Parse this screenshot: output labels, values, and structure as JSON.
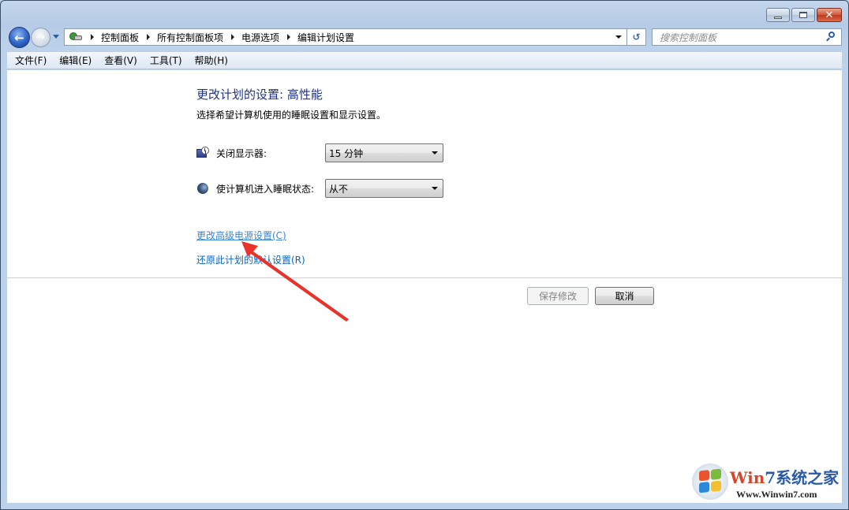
{
  "window": {
    "caption_buttons": {
      "minimize": "minimize",
      "maximize": "maximize",
      "close": "✕"
    }
  },
  "navigation": {
    "back_icon": "arrow-left-icon",
    "forward_icon": "arrow-right-icon",
    "back_glyph": "←",
    "forward_glyph": "→",
    "breadcrumbs": [
      "控制面板",
      "所有控制面板项",
      "电源选项",
      "编辑计划设置"
    ],
    "refresh_glyph": "↺",
    "search_placeholder": "搜索控制面板"
  },
  "menu": {
    "items": [
      "文件(F)",
      "编辑(E)",
      "查看(V)",
      "工具(T)",
      "帮助(H)"
    ]
  },
  "content": {
    "title": "更改计划的设置: 高性能",
    "subtitle": "选择希望计算机使用的睡眠设置和显示设置。",
    "settings": [
      {
        "label": "关闭显示器:",
        "value": "15 分钟",
        "icon": "monitor-clock-icon"
      },
      {
        "label": "使计算机进入睡眠状态:",
        "value": "从不",
        "icon": "sleep-moon-icon"
      }
    ],
    "links": {
      "advanced": "更改高级电源设置(C)",
      "restore": "还原此计划的默认设置(R)"
    },
    "buttons": {
      "save": "保存修改",
      "cancel": "取消"
    }
  },
  "watermark": {
    "title_w": "Win",
    "title_7": "7",
    "title_cn": "系统之家",
    "url": "Www.Winwin7.com"
  },
  "colors": {
    "title_blue": "#1e3287",
    "link_blue": "#0066cc",
    "annotation_red": "#e8332b"
  }
}
